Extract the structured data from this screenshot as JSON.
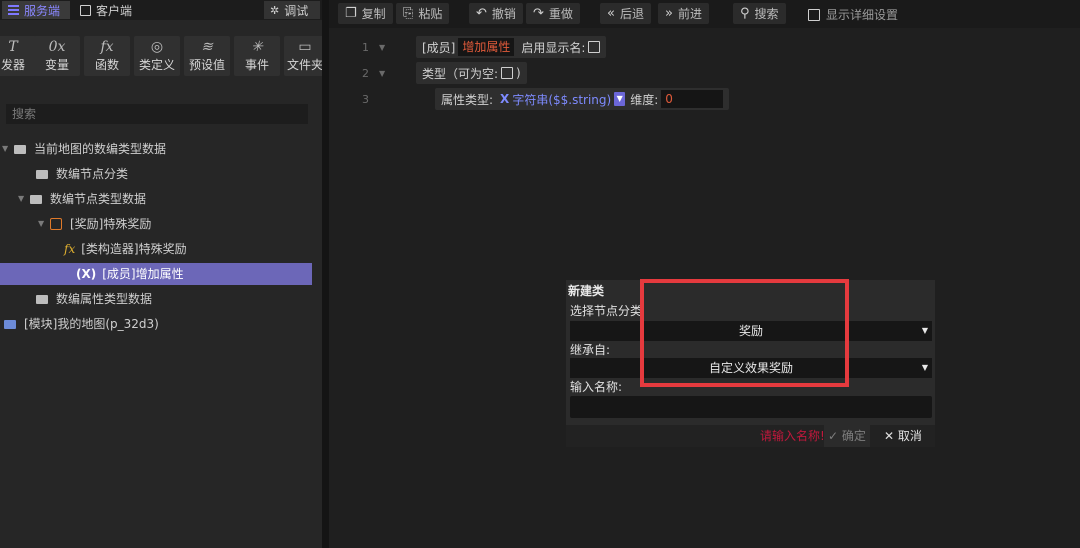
{
  "left_tabs": {
    "server": "服务端",
    "client": "客户端",
    "debug": "调试"
  },
  "tools": [
    {
      "icon": "T",
      "label": "发器"
    },
    {
      "icon": "0x",
      "label": "变量"
    },
    {
      "icon": "fx",
      "label": "函数"
    },
    {
      "icon": "◎",
      "label": "类定义"
    },
    {
      "icon": "≋",
      "label": "预设值"
    },
    {
      "icon": "✳",
      "label": "事件"
    },
    {
      "icon": "▭",
      "label": "文件夹"
    }
  ],
  "search_placeholder": "搜索",
  "tree": {
    "root": "当前地图的数编类型数据",
    "node_category": "数编节点分类",
    "node_type": "数编节点类型数据",
    "reward": "[奖励]特殊奖励",
    "constructor": "[类构造器]特殊奖励",
    "member": "[成员]增加属性",
    "attr_type": "数编属性类型数据",
    "module": "[模块]我的地图(p_32d3)"
  },
  "toolbar": {
    "copy": "复制",
    "paste": "粘贴",
    "undo": "撤销",
    "redo": "重做",
    "back": "后退",
    "forward": "前进",
    "search": "搜索",
    "detail": "显示详细设置"
  },
  "code": {
    "line1": "1",
    "line2": "2",
    "line3": "3",
    "member_prefix": "[成员]",
    "member_name": "增加属性",
    "show_name": "启用显示名:",
    "type_label": "类型（可为空:",
    "type_close": ")",
    "attr_type_label": "属性类型:",
    "attr_type_value": "字符串($$.string)",
    "dimension_label": "维度:",
    "dimension_value": "0"
  },
  "dialog": {
    "title": "新建类",
    "select_category_label": "选择节点分类",
    "select_category_value": "奖励",
    "inherit_label": "继承自:",
    "inherit_value": "自定义效果奖励",
    "name_label": "输入名称:",
    "warning": "请输入名称!",
    "ok": "确定",
    "cancel": "取消"
  },
  "colors": {
    "accent": "#6c67b8",
    "highlight": "#e53a3e",
    "warning": "#c0183c"
  }
}
